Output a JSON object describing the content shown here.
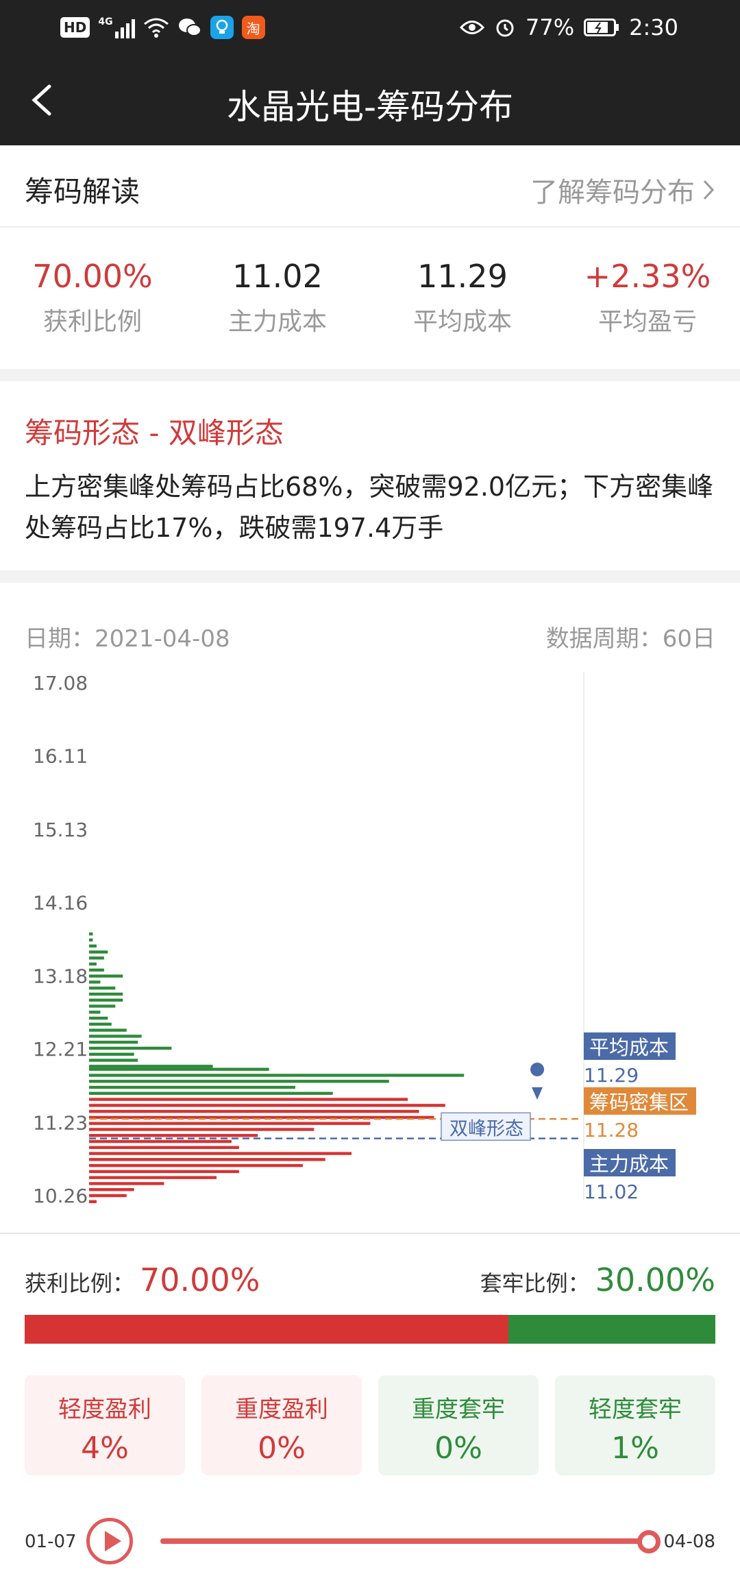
{
  "status_bar": {
    "left_badge": "HD",
    "network": "4G",
    "app_icons": [
      "wechat-icon",
      "bulb-app-icon",
      "taobao-icon"
    ],
    "taobao_label": "淘",
    "battery": "77%",
    "time": "2:30"
  },
  "header": {
    "title": "水晶光电-筹码分布"
  },
  "interpretation": {
    "title": "筹码解读",
    "link_label": "了解筹码分布"
  },
  "stats": [
    {
      "value": "70.00%",
      "label": "获利比例",
      "color": "#d03a3a"
    },
    {
      "value": "11.02",
      "label": "主力成本",
      "color": "#222222"
    },
    {
      "value": "11.29",
      "label": "平均成本",
      "color": "#222222"
    },
    {
      "value": "+2.33%",
      "label": "平均盈亏",
      "color": "#d03a3a"
    }
  ],
  "pattern": {
    "heading": "筹码形态 - 双峰形态",
    "description": "上方密集峰处筹码占比68%，突破需92.0亿元；下方密集峰处筹码占比17%，跌破需197.4万手"
  },
  "chart_meta": {
    "date_label": "日期：2021-04-08",
    "period_label": "数据周期：60日"
  },
  "chart_data": {
    "type": "bar",
    "orientation": "horizontal",
    "y_ticks": [
      "17.08",
      "16.11",
      "15.13",
      "14.16",
      "13.18",
      "12.21",
      "11.23",
      "10.26"
    ],
    "y_tick_values": [
      17.08,
      16.11,
      15.13,
      14.16,
      13.18,
      12.21,
      11.23,
      10.26
    ],
    "ylim": [
      10.26,
      17.08
    ],
    "price_step": 0.08,
    "series": [
      {
        "name": "",
        "color": "#2e8b3a",
        "bars": [
          [
            12.06,
            13
          ],
          [
            12.14,
            12
          ],
          [
            12.22,
            22
          ],
          [
            12.3,
            13
          ],
          [
            12.38,
            14
          ],
          [
            12.46,
            10
          ],
          [
            12.54,
            6
          ],
          [
            12.62,
            5
          ],
          [
            12.7,
            3
          ],
          [
            12.78,
            7
          ],
          [
            12.86,
            9
          ],
          [
            12.94,
            9
          ],
          [
            13.02,
            7
          ],
          [
            13.1,
            3
          ],
          [
            13.18,
            9
          ],
          [
            13.26,
            4
          ],
          [
            13.34,
            2
          ],
          [
            13.42,
            4
          ],
          [
            13.5,
            5
          ],
          [
            13.58,
            2
          ],
          [
            13.66,
            1
          ],
          [
            13.74,
            1
          ],
          [
            11.86,
            100
          ],
          [
            11.78,
            80
          ],
          [
            11.7,
            55
          ],
          [
            11.62,
            65
          ],
          [
            11.94,
            48
          ],
          [
            11.98,
            33
          ]
        ]
      },
      {
        "name": "",
        "color": "#d63333",
        "bars": [
          [
            11.54,
            85
          ],
          [
            11.46,
            95
          ],
          [
            11.38,
            88
          ],
          [
            11.3,
            92
          ],
          [
            11.22,
            75
          ],
          [
            11.14,
            60
          ],
          [
            11.06,
            45
          ],
          [
            10.98,
            38
          ],
          [
            10.9,
            40
          ],
          [
            10.82,
            70
          ],
          [
            10.74,
            63
          ],
          [
            10.66,
            57
          ],
          [
            10.58,
            40
          ],
          [
            10.5,
            34
          ],
          [
            10.42,
            20
          ],
          [
            10.34,
            12
          ],
          [
            10.26,
            10
          ],
          [
            10.18,
            2
          ]
        ]
      }
    ],
    "markers": [
      {
        "label": "平均成本",
        "value": "11.29",
        "price": 11.29,
        "color": "#4a6aa8",
        "line": false
      },
      {
        "label": "筹码密集区",
        "value": "11.28",
        "price": 11.28,
        "color": "#e0893a",
        "line": true
      },
      {
        "label": "主力成本",
        "value": "11.02",
        "price": 11.02,
        "color": "#4a6aa8",
        "line": true
      }
    ],
    "pattern_label": "双峰形态"
  },
  "ratio": {
    "profit_label": "获利比例：",
    "profit_value": "70.00%",
    "profit_fraction": 0.7,
    "trapped_label": "套牢比例：",
    "trapped_value": "30.00%"
  },
  "cards": [
    {
      "label": "轻度盈利",
      "value": "4%",
      "tone": "red"
    },
    {
      "label": "重度盈利",
      "value": "0%",
      "tone": "red"
    },
    {
      "label": "重度套牢",
      "value": "0%",
      "tone": "green"
    },
    {
      "label": "轻度套牢",
      "value": "1%",
      "tone": "green"
    }
  ],
  "player": {
    "start_date": "01-07",
    "end_date": "04-08",
    "progress": 1.0
  }
}
